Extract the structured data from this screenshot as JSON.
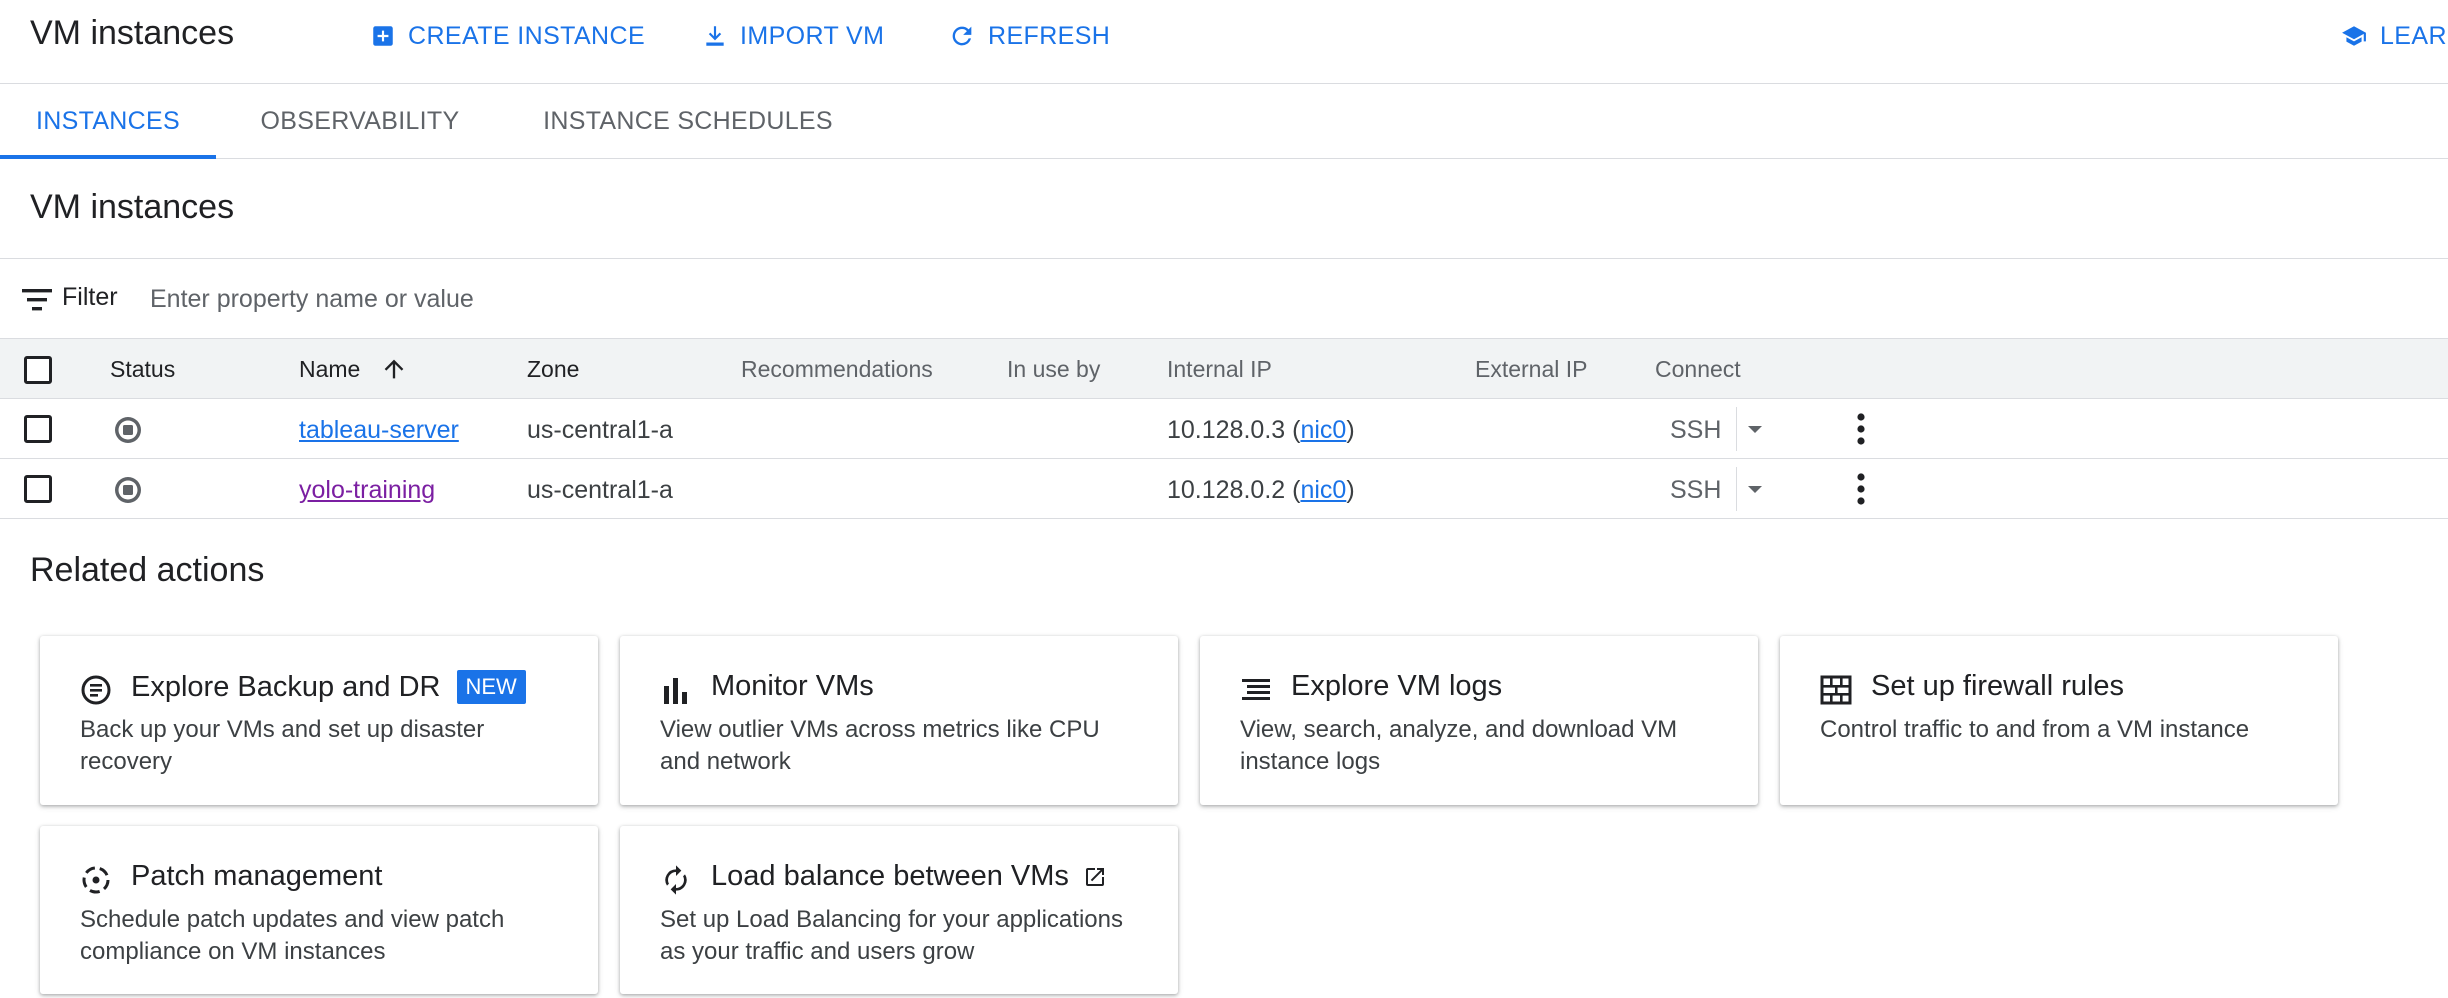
{
  "header": {
    "title": "VM instances",
    "actions": [
      {
        "label": "CREATE INSTANCE",
        "icon": "add-box-icon"
      },
      {
        "label": "IMPORT VM",
        "icon": "download-icon"
      },
      {
        "label": "REFRESH",
        "icon": "refresh-icon"
      },
      {
        "label": "LEARN",
        "icon": "school-icon"
      }
    ]
  },
  "tabs": [
    {
      "label": "INSTANCES",
      "active": true
    },
    {
      "label": "OBSERVABILITY",
      "active": false
    },
    {
      "label": "INSTANCE SCHEDULES",
      "active": false
    }
  ],
  "section": {
    "title": "VM instances"
  },
  "filter": {
    "label": "Filter",
    "placeholder": "Enter property name or value"
  },
  "table": {
    "columns": [
      "Status",
      "Name",
      "Zone",
      "Recommendations",
      "In use by",
      "Internal IP",
      "External IP",
      "Connect"
    ],
    "sort": {
      "column": "Name",
      "direction": "ascending"
    },
    "rows": [
      {
        "status": "stopped",
        "name": "tableau-server",
        "zone": "us-central1-a",
        "recommendations": "",
        "in_use_by": "",
        "internal_ip": "10.128.0.3",
        "nic": "nic0",
        "external_ip": "",
        "connect": "SSH"
      },
      {
        "status": "stopped",
        "name": "yolo-training",
        "zone": "us-central1-a",
        "recommendations": "",
        "in_use_by": "",
        "internal_ip": "10.128.0.2",
        "nic": "nic0",
        "external_ip": "",
        "connect": "SSH"
      }
    ],
    "ip_open": " (",
    "ip_close": ")"
  },
  "related": {
    "title": "Related actions",
    "cards": [
      {
        "title": "Explore Backup and DR",
        "badge": "NEW",
        "desc": "Back up your VMs and set up disaster recovery",
        "icon": "backup-icon"
      },
      {
        "title": "Monitor VMs",
        "desc": "View outlier VMs across metrics like CPU and network",
        "icon": "bar-chart-icon"
      },
      {
        "title": "Explore VM logs",
        "desc": "View, search, analyze, and download VM instance logs",
        "icon": "logs-icon"
      },
      {
        "title": "Set up firewall rules",
        "desc": "Control traffic to and from a VM instance",
        "icon": "firewall-icon"
      },
      {
        "title": "Patch management",
        "desc": "Schedule patch updates and view patch compliance on VM instances",
        "icon": "patch-icon"
      },
      {
        "title": "Load balance between VMs",
        "desc": "Set up Load Balancing for your applications as your traffic and users grow",
        "icon": "load-balance-icon",
        "external": true
      }
    ]
  },
  "colors": {
    "accent": "#1a73e8",
    "visited_link": "#7b1fa2",
    "text": "#202124",
    "secondary_text": "#5f6368",
    "divider": "#dadce0",
    "header_bg": "#f1f3f4"
  }
}
